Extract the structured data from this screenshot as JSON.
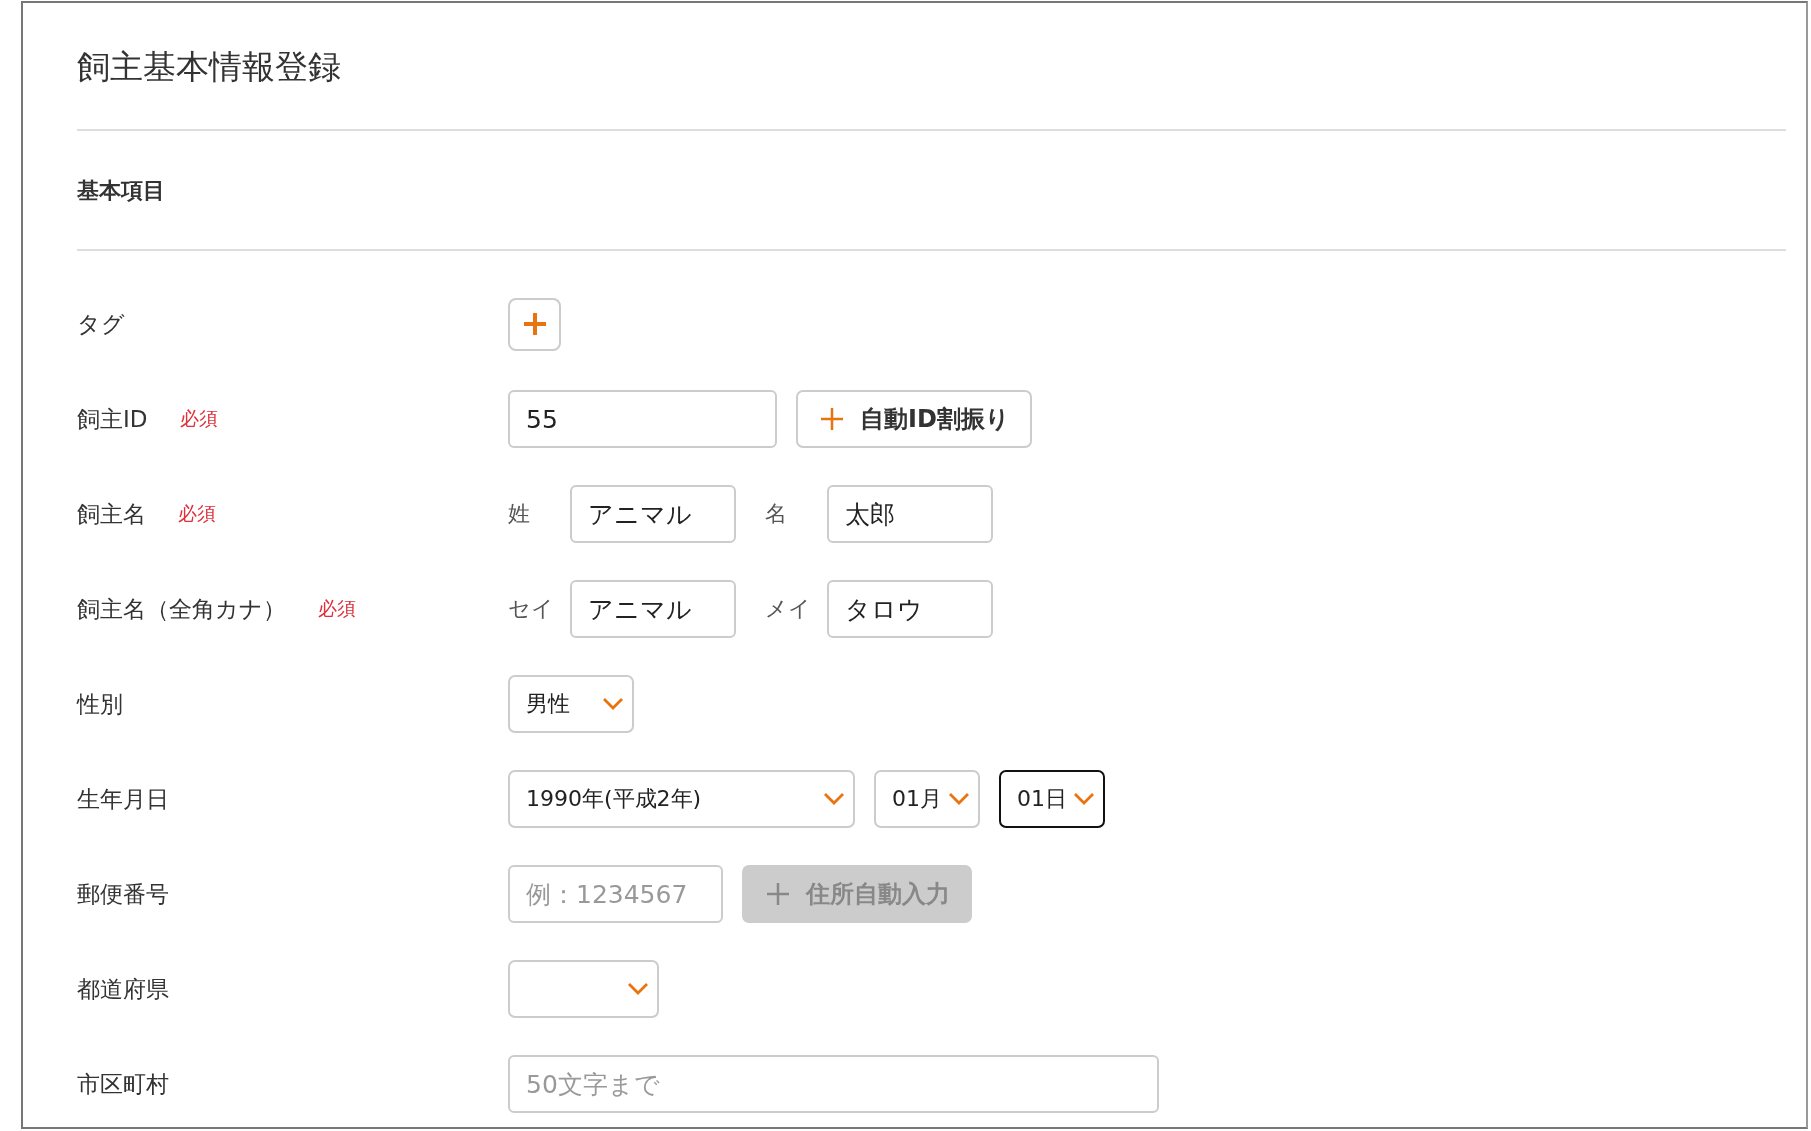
{
  "title": "飼主基本情報登録",
  "section": "基本項目",
  "fields": [
    {
      "kind": "tag",
      "label": "タグ"
    },
    {
      "kind": "id",
      "label": "飼主ID",
      "required_badge": "必須",
      "value": "55",
      "button": {
        "label": "自動ID割振り",
        "disabled": false
      }
    },
    {
      "kind": "pair",
      "label": "飼主名",
      "required_badge": "必須",
      "parts": [
        {
          "label": "姓",
          "value": "アニマル"
        },
        {
          "label": "名",
          "value": "太郎"
        }
      ]
    },
    {
      "kind": "pair",
      "label": "飼主名（全角カナ）",
      "required_badge": "必須",
      "parts": [
        {
          "label": "セイ",
          "value": "アニマル"
        },
        {
          "label": "メイ",
          "value": "タロウ"
        }
      ]
    },
    {
      "kind": "selects",
      "label": "性別",
      "selects": [
        {
          "value": "男性",
          "focused": false
        }
      ]
    },
    {
      "kind": "selects",
      "label": "生年月日",
      "selects": [
        {
          "value": "1990年(平成2年)",
          "focused": false
        },
        {
          "value": "01月",
          "focused": false
        },
        {
          "value": "01日",
          "focused": true
        }
      ]
    },
    {
      "kind": "postal",
      "label": "郵便番号",
      "placeholder": "例：1234567",
      "button": {
        "label": "住所自動入力",
        "disabled": true
      }
    },
    {
      "kind": "selects",
      "label": "都道府県",
      "selects": [
        {
          "focused": false
        }
      ]
    },
    {
      "kind": "text",
      "label": "市区町村",
      "placeholder": "50文字まで"
    }
  ]
}
